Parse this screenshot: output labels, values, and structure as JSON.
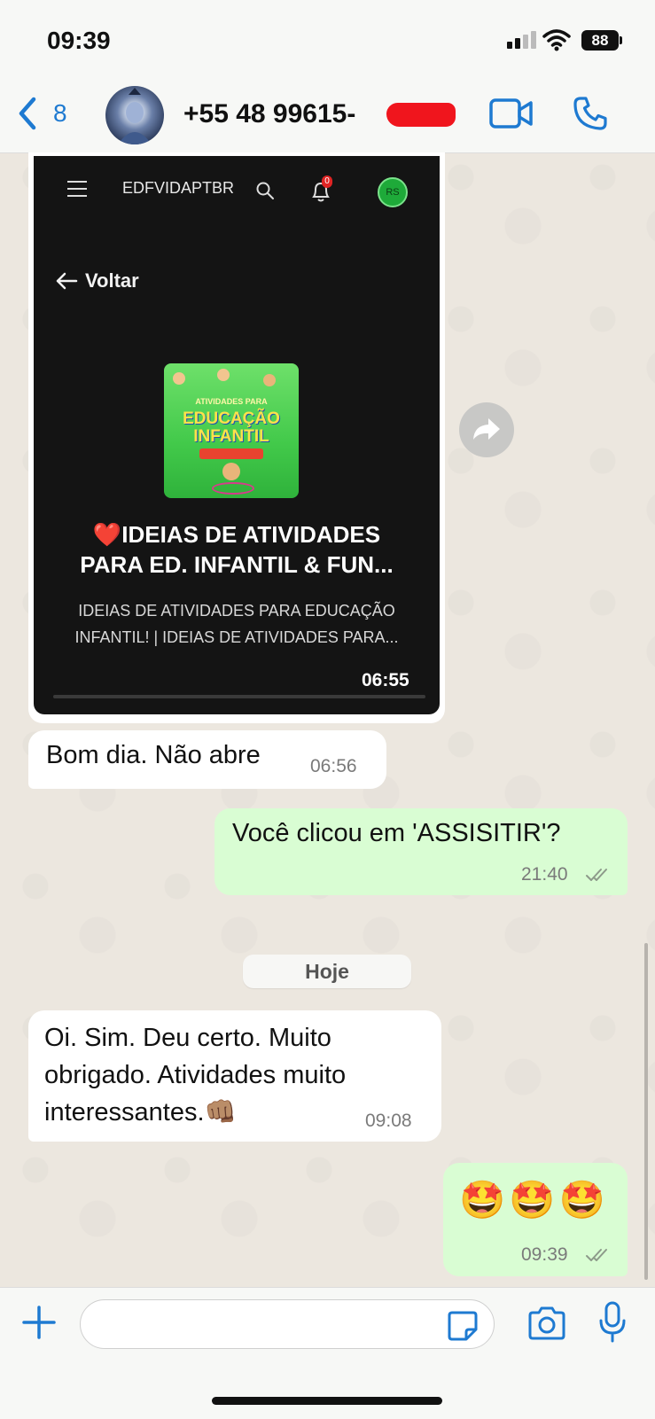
{
  "status_bar": {
    "time": "09:39",
    "battery": "88"
  },
  "header": {
    "back_count": "8",
    "contact_name": "+55 48 99615-"
  },
  "link_preview": {
    "site_name": "EDFVIDAPTBR",
    "notification_count": "0",
    "profile_initials": "RS",
    "back_label": "Voltar",
    "thumbnail": {
      "line1": "ATIVIDADES PARA",
      "line2": "EDUCAÇÃO",
      "line3": "INFANTIL"
    },
    "title": "❤️IDEIAS DE ATIVIDADES PARA ED. INFANTIL & FUN...",
    "description": "IDEIAS DE ATIVIDADES PARA EDUCAÇÃO INFANTIL! | IDEIAS DE ATIVIDADES PARA...",
    "time": "06:55"
  },
  "messages": [
    {
      "direction": "in",
      "text": "Bom dia. Não abre",
      "time": "06:56"
    },
    {
      "direction": "out",
      "text": "Você clicou em 'ASSISITIR'?",
      "time": "21:40"
    },
    {
      "direction": "in",
      "text": "Oi. Sim. Deu certo. Muito obrigado.  Atividades muito interessantes.👊🏽",
      "time": "09:08"
    },
    {
      "direction": "out",
      "text": "🤩🤩🤩",
      "time": "09:39"
    }
  ],
  "date_separator": "Hoje",
  "composer": {
    "placeholder": ""
  },
  "colors": {
    "accent": "#1e7ad1",
    "outgoing_bubble": "#d9fdd3",
    "incoming_bubble": "#ffffff",
    "redaction": "#f0151d"
  },
  "icons": [
    "back-chevron-icon",
    "video-call-icon",
    "phone-icon",
    "forward-icon",
    "plus-icon",
    "sticker-icon",
    "camera-icon",
    "microphone-icon"
  ]
}
